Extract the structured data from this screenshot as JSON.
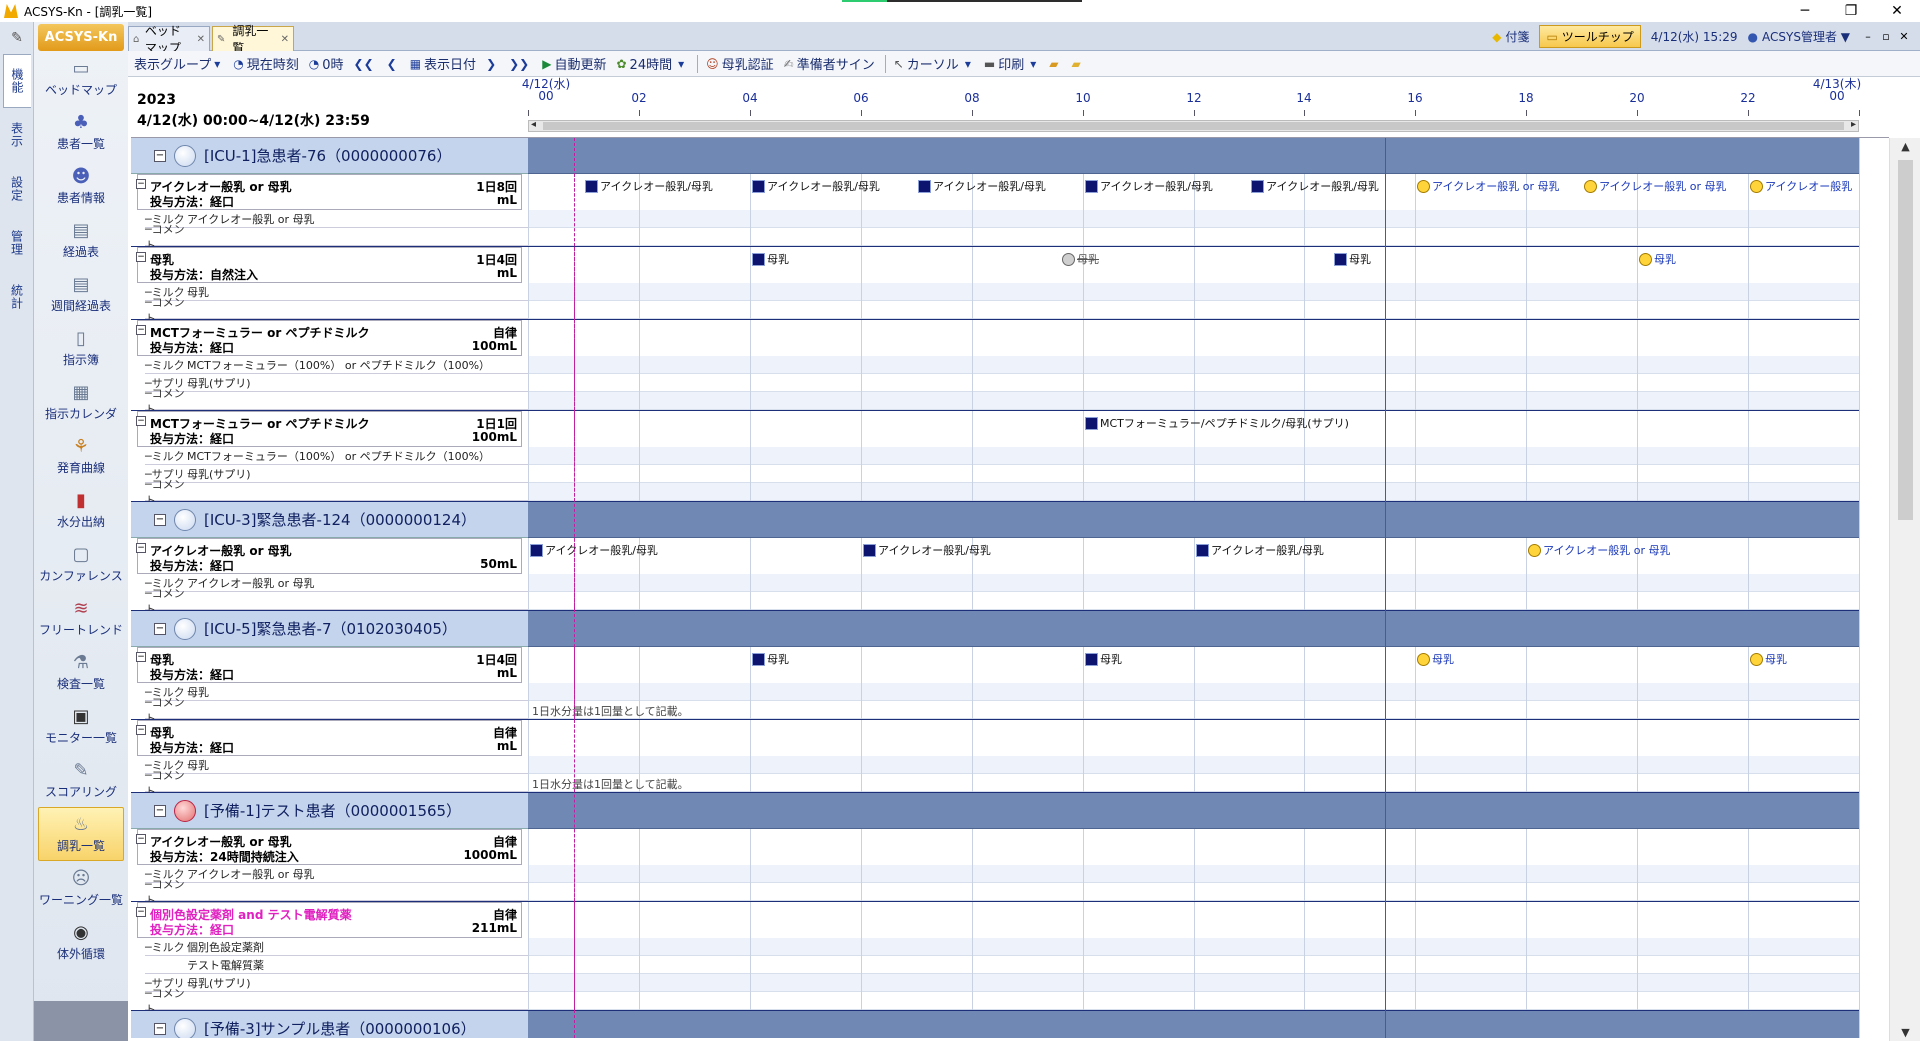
{
  "window": {
    "title": "ACSYS-Kn - [調乳一覧]",
    "minimize": "─",
    "restore": "❐",
    "close": "✕"
  },
  "leftbar": {
    "tabs": [
      "機能",
      "表示",
      "設定",
      "管理",
      "統計"
    ]
  },
  "sidebar": {
    "brand": "ACSYS-Kn",
    "items": [
      {
        "label": "ベッドマップ",
        "icon": "bed-icon"
      },
      {
        "label": "患者一覧",
        "icon": "patients-icon"
      },
      {
        "label": "患者情報",
        "icon": "patient-info-icon"
      },
      {
        "label": "経過表",
        "icon": "chart-icon"
      },
      {
        "label": "週間経過表",
        "icon": "weekly-chart-icon"
      },
      {
        "label": "指示簿",
        "icon": "order-book-icon"
      },
      {
        "label": "指示カレンダ",
        "icon": "calendar-icon"
      },
      {
        "label": "発育曲線",
        "icon": "growth-icon"
      },
      {
        "label": "水分出納",
        "icon": "bar-chart-icon"
      },
      {
        "label": "カンファレンス",
        "icon": "conference-icon"
      },
      {
        "label": "フリートレンド",
        "icon": "trend-icon"
      },
      {
        "label": "検査一覧",
        "icon": "microscope-icon"
      },
      {
        "label": "モニター一覧",
        "icon": "monitor-icon"
      },
      {
        "label": "スコアリング",
        "icon": "scoring-icon"
      },
      {
        "label": "調乳一覧",
        "icon": "milk-icon"
      },
      {
        "label": "ワーニング一覧",
        "icon": "warning-icon"
      },
      {
        "label": "体外循環",
        "icon": "circulation-icon"
      }
    ],
    "active_index": 14
  },
  "tabs": [
    {
      "label": "ベッドマップ",
      "close": "✕"
    },
    {
      "label": "調乳一覧",
      "close": "✕"
    }
  ],
  "tabright": {
    "sticky": "付箋",
    "tooltip": "ツールチップ",
    "datetime": "4/12(水) 15:29",
    "user": "ACSYS管理者 ▼",
    "mini_min": "–",
    "mini_restore": "▫",
    "mini_close": "✕"
  },
  "toolbar": {
    "display_group": "表示グループ",
    "now": "現在時刻",
    "zero": "0時",
    "display_date": "表示日付",
    "auto_update": "自動更新",
    "hours": "24時間",
    "milk_auth": "母乳認証",
    "preparer_sign": "準備者サイン",
    "cursor": "カーソル",
    "print": "印刷"
  },
  "header": {
    "year": "2023",
    "range": "4/12(水) 00:00~4/12(水) 23:59",
    "ticks": [
      {
        "label": "4/12(水)\n00",
        "hour": 0
      },
      {
        "label": "02",
        "hour": 2
      },
      {
        "label": "04",
        "hour": 4
      },
      {
        "label": "06",
        "hour": 6
      },
      {
        "label": "08",
        "hour": 8
      },
      {
        "label": "10",
        "hour": 10
      },
      {
        "label": "12",
        "hour": 12
      },
      {
        "label": "14",
        "hour": 14
      },
      {
        "label": "16",
        "hour": 16
      },
      {
        "label": "18",
        "hour": 18
      },
      {
        "label": "20",
        "hour": 20
      },
      {
        "label": "22",
        "hour": 22
      },
      {
        "label": "4/13(木)\n00",
        "hour": 24
      }
    ]
  },
  "labels": {
    "milk": "ミルク",
    "supple": "サプリ",
    "comment": "コメント"
  },
  "patients": [
    {
      "name": "[ICU-1]急患者-76（0000000076）",
      "circle": "blue",
      "orders": [
        {
          "name": "アイクレオー般乳 or 母乳",
          "method": "投与方法：経口",
          "freq": "1日8回",
          "amount": "mL",
          "subs": [
            {
              "k": "ミルク",
              "v": "アイクレオー般乳 or 母乳"
            },
            {
              "k": "コメント",
              "v": ""
            }
          ],
          "events": [
            {
              "hour": 1,
              "type": "sq",
              "label": "アイクレオー般乳/母乳"
            },
            {
              "hour": 4,
              "type": "sq",
              "label": "アイクレオー般乳/母乳"
            },
            {
              "hour": 7,
              "type": "sq",
              "label": "アイクレオー般乳/母乳"
            },
            {
              "hour": 10,
              "type": "sq",
              "label": "アイクレオー般乳/母乳"
            },
            {
              "hour": 13,
              "type": "sq",
              "label": "アイクレオー般乳/母乳"
            },
            {
              "hour": 16,
              "type": "ci",
              "label": "アイクレオー般乳 or 母乳"
            },
            {
              "hour": 19,
              "type": "ci",
              "label": "アイクレオー般乳 or 母乳"
            },
            {
              "hour": 22,
              "type": "ci",
              "label": "アイクレオー般乳 or 母乳"
            }
          ]
        },
        {
          "name": "母乳",
          "method": "投与方法：自然注入",
          "freq": "1日4回",
          "amount": "mL",
          "subs": [
            {
              "k": "ミルク",
              "v": "母乳"
            },
            {
              "k": "コメント",
              "v": ""
            }
          ],
          "events": [
            {
              "hour": 4,
              "type": "sq",
              "label": "母乳"
            },
            {
              "hour": 9.6,
              "type": "cg",
              "label": "母乳",
              "strike": true
            },
            {
              "hour": 14.5,
              "type": "sq",
              "label": "母乳"
            },
            {
              "hour": 20,
              "type": "ci",
              "label": "母乳"
            }
          ]
        },
        {
          "name": "MCTフォーミュラー or ペプチドミルク",
          "method": "投与方法：経口",
          "freq": "自律",
          "amount": "100mL",
          "subs": [
            {
              "k": "ミルク",
              "v": "MCTフォーミュラー（100%） or ペプチドミルク（100%）"
            },
            {
              "k": "サプリ",
              "v": "母乳(サプリ)"
            },
            {
              "k": "コメント",
              "v": ""
            }
          ],
          "events": []
        },
        {
          "name": "MCTフォーミュラー or ペプチドミルク",
          "method": "投与方法：経口",
          "freq": "1日1回",
          "amount": "100mL",
          "subs": [
            {
              "k": "ミルク",
              "v": "MCTフォーミュラー（100%） or ペプチドミルク（100%）"
            },
            {
              "k": "サプリ",
              "v": "母乳(サプリ)"
            },
            {
              "k": "コメント",
              "v": ""
            }
          ],
          "events": [
            {
              "hour": 10,
              "type": "sq",
              "label": "MCTフォーミュラー/ペプチドミルク/母乳(サプリ)"
            }
          ]
        }
      ]
    },
    {
      "name": "[ICU-3]緊急患者-124（0000000124）",
      "circle": "blue",
      "orders": [
        {
          "name": "アイクレオー般乳 or 母乳",
          "method": "投与方法：経口",
          "freq": "",
          "amount": "50mL",
          "subs": [
            {
              "k": "ミルク",
              "v": "アイクレオー般乳 or 母乳"
            },
            {
              "k": "コメント",
              "v": ""
            }
          ],
          "events": [
            {
              "hour": 0,
              "type": "sq",
              "label": "アイクレオー般乳/母乳"
            },
            {
              "hour": 6,
              "type": "sq",
              "label": "アイクレオー般乳/母乳"
            },
            {
              "hour": 12,
              "type": "sq",
              "label": "アイクレオー般乳/母乳"
            },
            {
              "hour": 18,
              "type": "ci",
              "label": "アイクレオー般乳 or 母乳"
            }
          ]
        }
      ]
    },
    {
      "name": "[ICU-5]緊急患者-7（0102030405）",
      "circle": "blue",
      "orders": [
        {
          "name": "母乳",
          "method": "投与方法：経口",
          "freq": "1日4回",
          "amount": "mL",
          "subs": [
            {
              "k": "ミルク",
              "v": "母乳"
            },
            {
              "k": "コメント",
              "v": ""
            }
          ],
          "note": "1日水分量は1回量として記載。",
          "events": [
            {
              "hour": 4,
              "type": "sq",
              "label": "母乳"
            },
            {
              "hour": 10,
              "type": "sq",
              "label": "母乳"
            },
            {
              "hour": 16,
              "type": "ci",
              "label": "母乳"
            },
            {
              "hour": 22,
              "type": "ci",
              "label": "母乳"
            }
          ]
        },
        {
          "name": "母乳",
          "method": "投与方法：経口",
          "freq": "自律",
          "amount": "mL",
          "subs": [
            {
              "k": "ミルク",
              "v": "母乳"
            },
            {
              "k": "コメント",
              "v": ""
            }
          ],
          "note": "1日水分量は1回量として記載。",
          "events": []
        }
      ]
    },
    {
      "name": "[予備-1]テスト患者（0000001565）",
      "circle": "red",
      "orders": [
        {
          "name": "アイクレオー般乳 or 母乳",
          "method": "投与方法：24時間持続注入",
          "freq": "自律",
          "amount": "1000mL",
          "subs": [
            {
              "k": "ミルク",
              "v": "アイクレオー般乳 or 母乳"
            },
            {
              "k": "コメント",
              "v": ""
            }
          ],
          "events": []
        },
        {
          "name": "個別色設定薬剤 and テスト電解質薬",
          "method": "投与方法：経口",
          "freq": "自律",
          "amount": "211mL",
          "pink": true,
          "subs": [
            {
              "k": "ミルク",
              "v": "個別色設定薬剤"
            },
            {
              "k": "",
              "v": "テスト電解質薬"
            },
            {
              "k": "サプリ",
              "v": "母乳(サプリ)"
            },
            {
              "k": "コメント",
              "v": ""
            }
          ],
          "events": []
        }
      ]
    },
    {
      "name": "[予備-3]サンプル患者（0000000106）",
      "circle": "blue",
      "orders": []
    }
  ]
}
